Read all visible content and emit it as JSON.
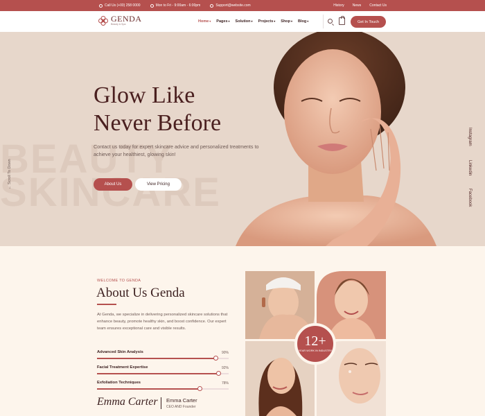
{
  "topbar": {
    "phone": "Call Us (+00) 258 0000",
    "hours": "Mon to Fri - 9:00am - 6:00pm",
    "email": "Support@website.com",
    "links": [
      "History",
      "News",
      "Contact Us"
    ]
  },
  "header": {
    "brand": "GENDA",
    "tagline": "Beauty & Spa",
    "nav": [
      {
        "label": "Home",
        "active": true
      },
      {
        "label": "Pages",
        "active": false
      },
      {
        "label": "Solution",
        "active": false
      },
      {
        "label": "Projects",
        "active": false
      },
      {
        "label": "Shop",
        "active": false
      },
      {
        "label": "Blog",
        "active": false
      }
    ],
    "cta": "Get In Touch",
    "icons": [
      "search-icon",
      "cart-icon"
    ]
  },
  "hero": {
    "title_line1": "Glow Like",
    "title_line2": "Never Before",
    "description": "Contact us today for expert skincare advice and personalized treatments to achieve your healthiest, glowing skin!",
    "watermark": "BEAUTY SKINCARE",
    "btn_primary": "About Us",
    "btn_secondary": "View Pricing",
    "scroll": "Scroll To Down",
    "social": [
      "Instagram",
      "Linkedin",
      "Facebook"
    ]
  },
  "about": {
    "eyebrow": "WELCOME TO GENDA",
    "heading": "About Us Genda",
    "body": "At Genda, we specialize in delivering personalized skincare solutions that enhance beauty, promote healthy skin, and boost confidence. Our expert team ensures exceptional care and visible results.",
    "skills": [
      {
        "label": "Advanced Skin Analysis",
        "value": 90
      },
      {
        "label": "Facial Treatment Expertise",
        "value": 92
      },
      {
        "label": "Exfoliation Techniques",
        "value": 78
      }
    ],
    "signature": "Emma Carter",
    "person_name": "Emma Carter",
    "person_role": "CEO AND Founder",
    "badge_number": "12+",
    "badge_label": "YEAR WORK IN INDUSTRY"
  },
  "colors": {
    "accent": "#b5504e",
    "hero_bg": "#e7d7cb",
    "about_bg": "#fdf5ec"
  }
}
